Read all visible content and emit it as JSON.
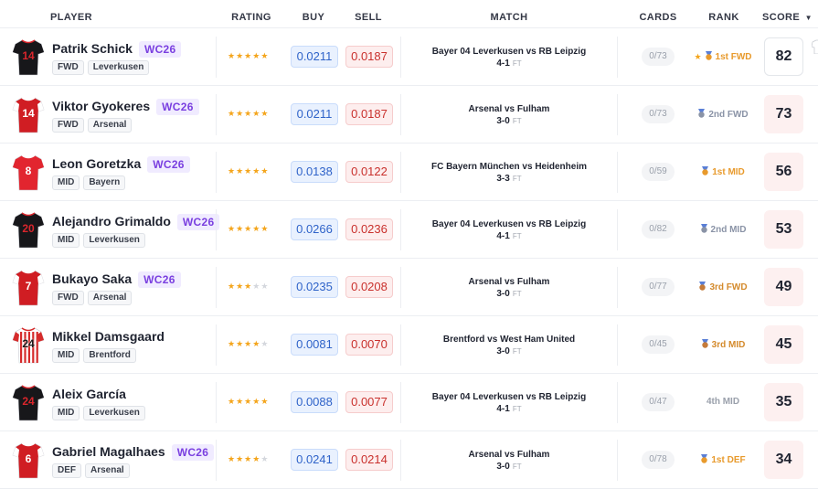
{
  "columns": {
    "player": "PLAYER",
    "rating": "RATING",
    "buy": "BUY",
    "sell": "SELL",
    "match": "MATCH",
    "cards": "CARDS",
    "rank": "RANK",
    "score": "SCORE",
    "score_sort_icon": "caret-down-icon"
  },
  "colors": {
    "wc_badge": "#7a3fe0",
    "buy_text": "#2f63c9",
    "sell_text": "#c9302c",
    "star_on": "#f4a51c",
    "rank_gold": "#e89a2c",
    "rank_silver": "#8a93a6"
  },
  "players": [
    {
      "name": "Patrik Schick",
      "badge": "WC26",
      "position": "FWD",
      "team": "Leverkusen",
      "jersey": "14",
      "kit": "leverkusen",
      "rating": 5,
      "buy": "0.0211",
      "sell": "0.0187",
      "match": "Bayer 04 Leverkusen vs RB Leipzig",
      "result": "4-1",
      "status": "FT",
      "cards": "0/73",
      "rank": "1st FWD",
      "rank_tier": "gold",
      "rank_star": true,
      "score": "82"
    },
    {
      "name": "Viktor Gyokeres",
      "badge": "WC26",
      "position": "FWD",
      "team": "Arsenal",
      "jersey": "14",
      "kit": "arsenal",
      "rating": 5,
      "buy": "0.0211",
      "sell": "0.0187",
      "match": "Arsenal vs Fulham",
      "result": "3-0",
      "status": "FT",
      "cards": "0/73",
      "rank": "2nd FWD",
      "rank_tier": "silver",
      "rank_star": false,
      "score": "73"
    },
    {
      "name": "Leon Goretzka",
      "badge": "WC26",
      "position": "MID",
      "team": "Bayern",
      "jersey": "8",
      "kit": "bayern",
      "rating": 5,
      "buy": "0.0138",
      "sell": "0.0122",
      "match": "FC Bayern München vs Heidenheim",
      "result": "3-3",
      "status": "FT",
      "cards": "0/59",
      "rank": "1st MID",
      "rank_tier": "gold",
      "rank_star": false,
      "score": "56"
    },
    {
      "name": "Alejandro Grimaldo",
      "badge": "WC26",
      "position": "MID",
      "team": "Leverkusen",
      "jersey": "20",
      "kit": "leverkusen",
      "rating": 5,
      "buy": "0.0266",
      "sell": "0.0236",
      "match": "Bayer 04 Leverkusen vs RB Leipzig",
      "result": "4-1",
      "status": "FT",
      "cards": "0/82",
      "rank": "2nd MID",
      "rank_tier": "silver",
      "rank_star": false,
      "score": "53"
    },
    {
      "name": "Bukayo Saka",
      "badge": "WC26",
      "position": "FWD",
      "team": "Arsenal",
      "jersey": "7",
      "kit": "arsenal",
      "rating": 3,
      "buy": "0.0235",
      "sell": "0.0208",
      "match": "Arsenal vs Fulham",
      "result": "3-0",
      "status": "FT",
      "cards": "0/77",
      "rank": "3rd FWD",
      "rank_tier": "bronze",
      "rank_star": false,
      "score": "49"
    },
    {
      "name": "Mikkel Damsgaard",
      "badge": "",
      "position": "MID",
      "team": "Brentford",
      "jersey": "24",
      "kit": "brentford",
      "rating": 4,
      "buy": "0.0081",
      "sell": "0.0070",
      "match": "Brentford vs West Ham United",
      "result": "3-0",
      "status": "FT",
      "cards": "0/45",
      "rank": "3rd MID",
      "rank_tier": "bronze",
      "rank_star": false,
      "score": "45"
    },
    {
      "name": "Aleix García",
      "badge": "",
      "position": "MID",
      "team": "Leverkusen",
      "jersey": "24",
      "kit": "leverkusen",
      "rating": 5,
      "buy": "0.0088",
      "sell": "0.0077",
      "match": "Bayer 04 Leverkusen vs RB Leipzig",
      "result": "4-1",
      "status": "FT",
      "cards": "0/47",
      "rank": "4th MID",
      "rank_tier": "none",
      "rank_star": false,
      "score": "35"
    },
    {
      "name": "Gabriel Magalhaes",
      "badge": "WC26",
      "position": "DEF",
      "team": "Arsenal",
      "jersey": "6",
      "kit": "arsenal",
      "rating": 4,
      "buy": "0.0241",
      "sell": "0.0214",
      "match": "Arsenal vs Fulham",
      "result": "3-0",
      "status": "FT",
      "cards": "0/78",
      "rank": "1st DEF",
      "rank_tier": "gold",
      "rank_star": false,
      "score": "34"
    }
  ]
}
